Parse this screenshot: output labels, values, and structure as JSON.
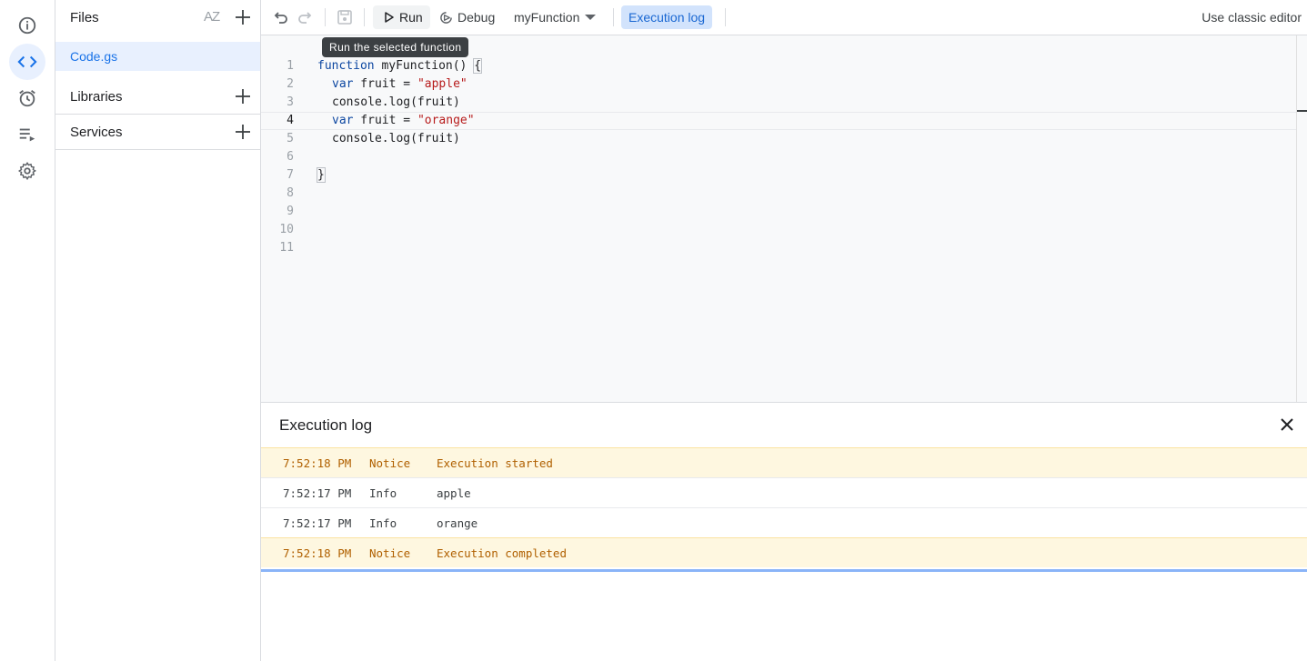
{
  "files_panel": {
    "title": "Files",
    "sort_label": "AZ",
    "file": "Code.gs",
    "libraries": "Libraries",
    "services": "Services"
  },
  "toolbar": {
    "run_label": "Run",
    "debug_label": "Debug",
    "function_selected": "myFunction",
    "execution_log_label": "Execution log",
    "classic_label": "Use classic editor",
    "tooltip": "Run the selected function"
  },
  "editor": {
    "line_numbers": [
      "1",
      "2",
      "3",
      "4",
      "5",
      "6",
      "7",
      "8",
      "9",
      "10",
      "11"
    ],
    "active_line": "4",
    "code": {
      "l1_kw": "function",
      "l1_rest": " myFunction() ",
      "l1_brace": "{",
      "l2_kw": "var",
      "l2_mid": " fruit = ",
      "l2_str": "\"apple\"",
      "l3": "console.log(fruit)",
      "l4_kw": "var",
      "l4_mid": " fruit = ",
      "l4_str": "\"orange\"",
      "l5": "console.log(fruit)",
      "l7_brace": "}"
    }
  },
  "execution_log": {
    "title": "Execution log",
    "rows": [
      {
        "time": "7:52:18 PM",
        "level": "Notice",
        "message": "Execution started"
      },
      {
        "time": "7:52:17 PM",
        "level": "Info",
        "message": "apple"
      },
      {
        "time": "7:52:17 PM",
        "level": "Info",
        "message": "orange"
      },
      {
        "time": "7:52:18 PM",
        "level": "Notice",
        "message": "Execution completed"
      }
    ]
  },
  "colors": {
    "accent": "#1a73e8",
    "notice_bg": "#fef7e0",
    "notice_text": "#b06000",
    "keyword": "#0d47a1",
    "string": "#b71c1c"
  },
  "icons": {
    "rail": [
      "info-icon",
      "code-icon",
      "alarm-clock-icon",
      "executions-icon",
      "gear-icon"
    ],
    "toolbar": [
      "undo-icon",
      "redo-icon",
      "save-icon",
      "play-icon",
      "debug-icon",
      "chevron-down-icon"
    ]
  }
}
